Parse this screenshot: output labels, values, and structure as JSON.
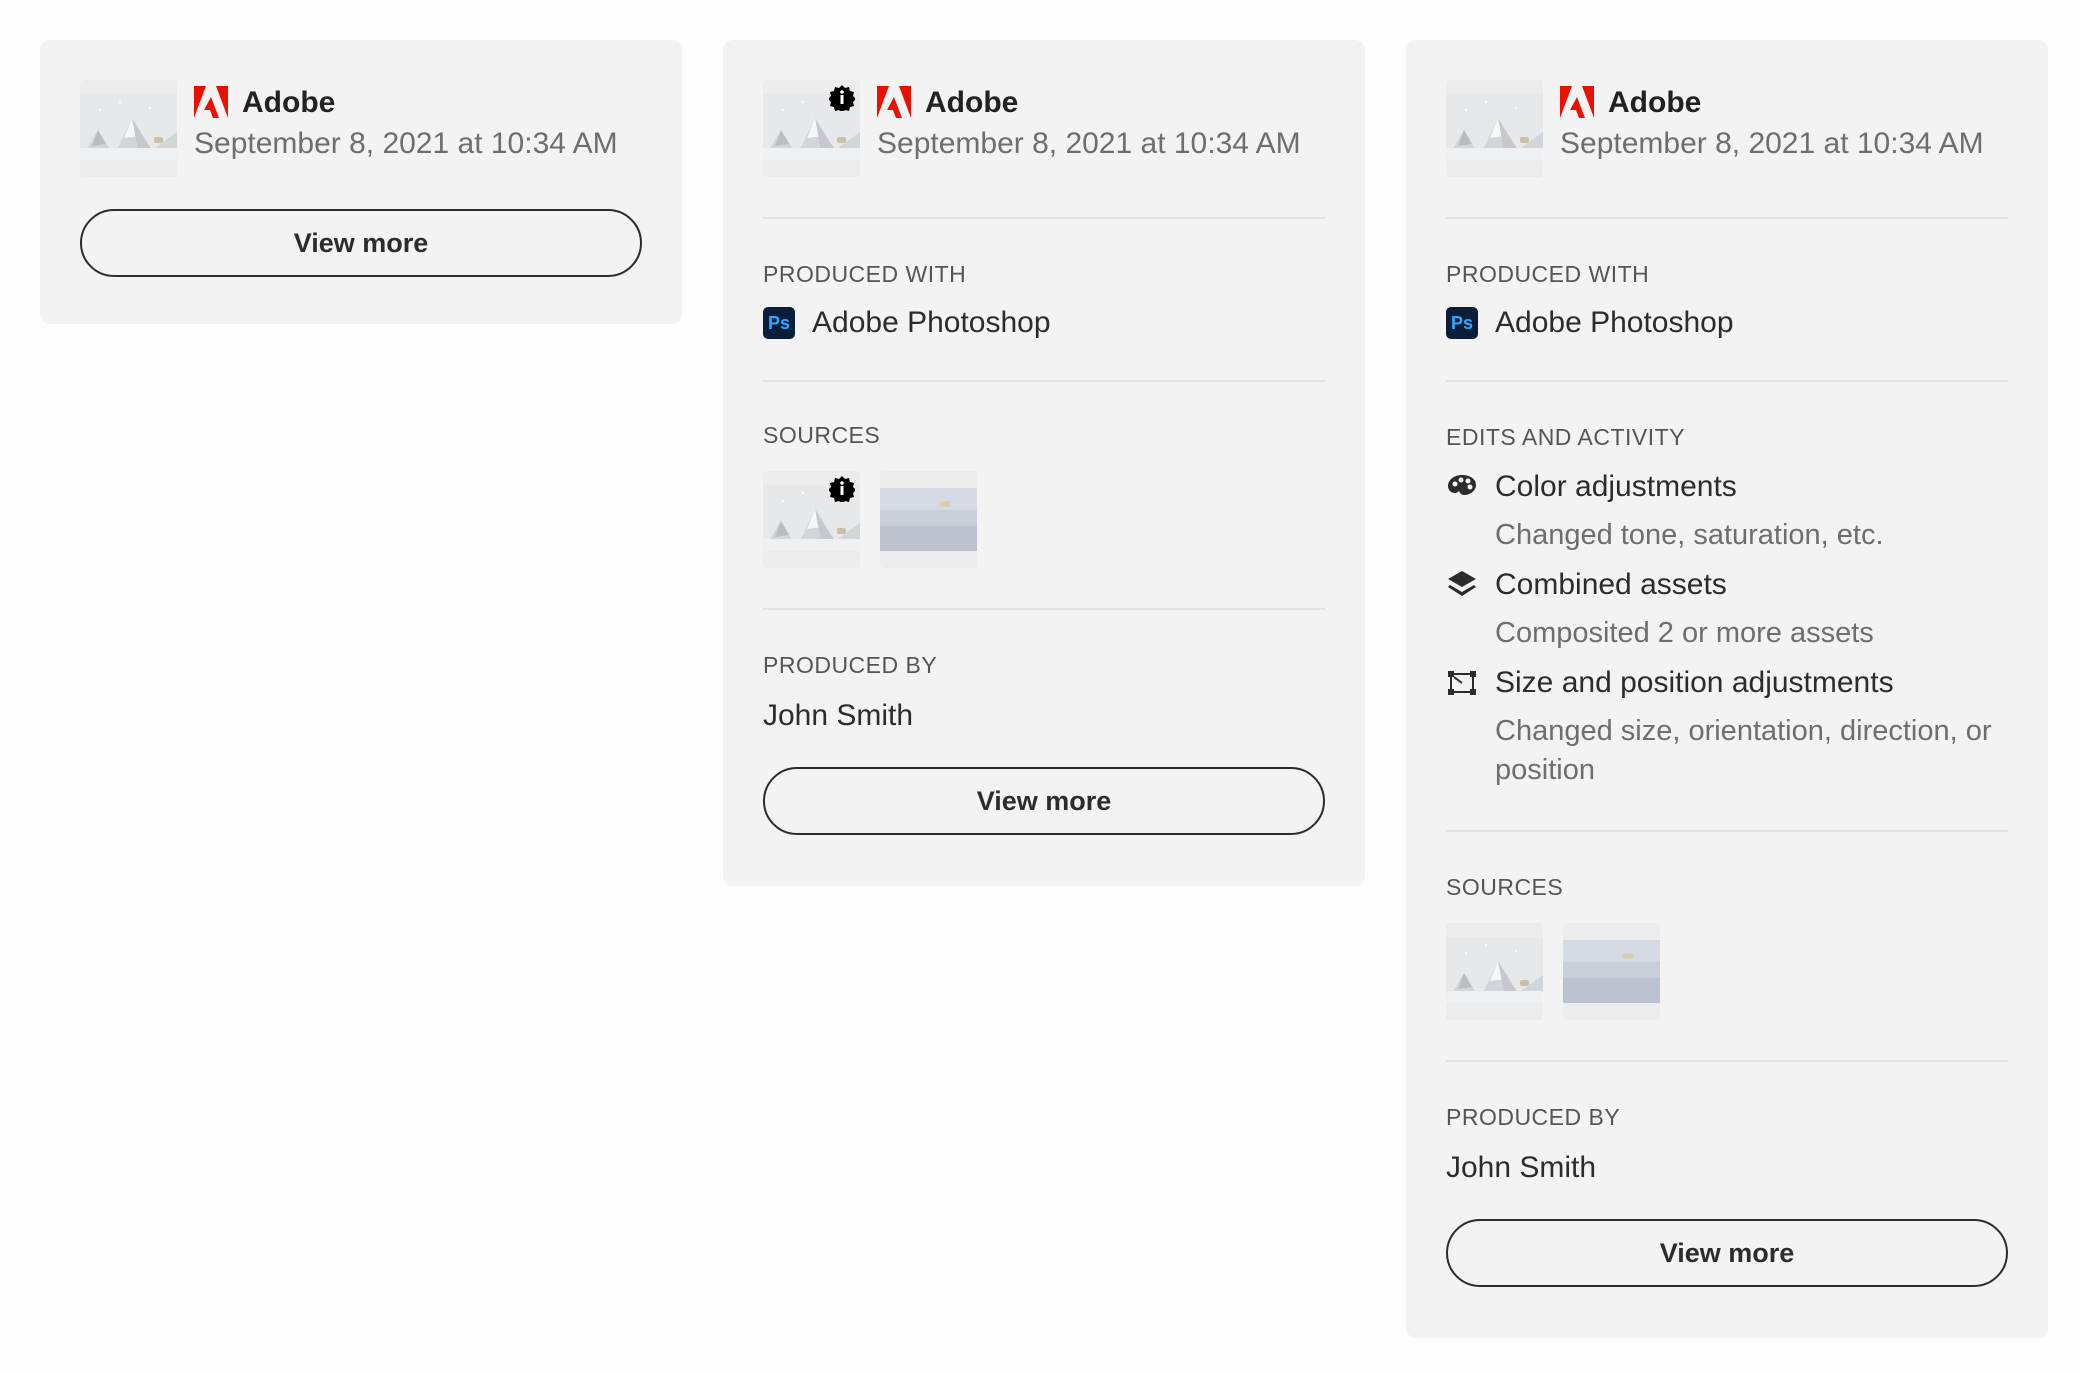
{
  "cards": [
    {
      "issuer": "Adobe",
      "date": "September 8, 2021 at 10:34 AM",
      "button": "View more"
    },
    {
      "issuer": "Adobe",
      "date": "September 8, 2021 at 10:34 AM",
      "produced_with_label": "PRODUCED WITH",
      "app": "Adobe Photoshop",
      "app_icon_text": "Ps",
      "sources_label": "SOURCES",
      "produced_by_label": "PRODUCED BY",
      "producer": "John Smith",
      "button": "View more"
    },
    {
      "issuer": "Adobe",
      "date": "September 8, 2021 at 10:34 AM",
      "produced_with_label": "PRODUCED WITH",
      "app": "Adobe Photoshop",
      "app_icon_text": "Ps",
      "edits_label": "EDITS AND ACTIVITY",
      "edits": [
        {
          "icon": "color-palette-icon",
          "title": "Color adjustments",
          "desc": "Changed tone, saturation, etc."
        },
        {
          "icon": "layers-icon",
          "title": "Combined assets",
          "desc": "Composited 2 or more assets"
        },
        {
          "icon": "crop-transform-icon",
          "title": "Size and position adjustments",
          "desc": "Changed size, orientation, direction, or position"
        }
      ],
      "sources_label": "SOURCES",
      "produced_by_label": "PRODUCED BY",
      "producer": "John Smith",
      "button": "View more"
    }
  ],
  "colors": {
    "card_bg": "#f3f3f3",
    "adobe_red": "#eb1000",
    "ps_bg": "#0a1e3a",
    "ps_fg": "#31a8ff"
  }
}
